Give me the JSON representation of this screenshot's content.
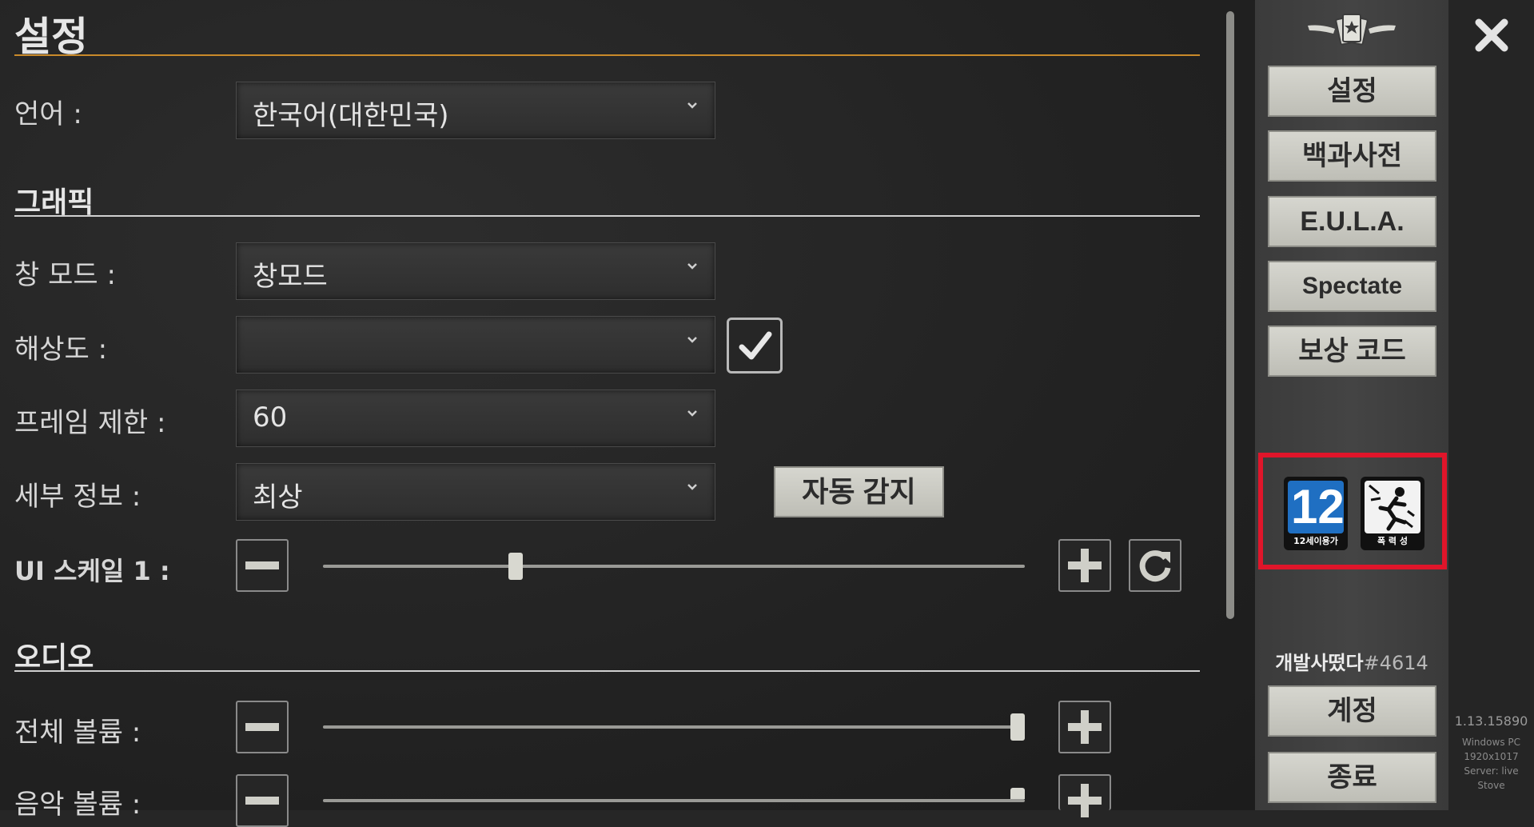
{
  "header": {
    "title": "설정"
  },
  "language": {
    "label": "언어 :",
    "value": "한국어(대한민국)"
  },
  "graphics": {
    "section_title": "그래픽",
    "window_mode": {
      "label": "창 모드 :",
      "value": "창모드"
    },
    "resolution": {
      "label": "해상도 :",
      "value": "",
      "checkbox_checked": true
    },
    "frame_limit": {
      "label": "프레임 제한 :",
      "value": "60"
    },
    "detail": {
      "label": "세부 정보 :",
      "value": "최상",
      "auto_detect_label": "자동 감지"
    },
    "ui_scale": {
      "label": "UI 스케일 1 :",
      "slider_fraction": 0.27
    }
  },
  "audio": {
    "section_title": "오디오",
    "master_volume": {
      "label": "전체 볼륨 :",
      "slider_fraction": 1.0
    },
    "music_volume": {
      "label": "음악 볼륨 :",
      "slider_fraction": 1.0
    }
  },
  "sidebar": {
    "buttons": [
      "설정",
      "백과사전",
      "E.U.L.A.",
      "Spectate",
      "보상 코드"
    ],
    "ratings": {
      "age_label": "12세이용가",
      "age_number": "12",
      "violence_label": "폭 력 성"
    },
    "user_name": "개발사떴다",
    "user_tag": "#4614",
    "account_button": "계정",
    "quit_button": "종료"
  },
  "info": {
    "version": "1.13.15890",
    "platform": "Windows PC",
    "resolution": "1920x1017",
    "server": "Server: live",
    "store": "Stove"
  },
  "colors": {
    "accent_rule": "#c98a2a",
    "rating_highlight": "#e0152a",
    "button_stone": "#cfcfc8"
  }
}
